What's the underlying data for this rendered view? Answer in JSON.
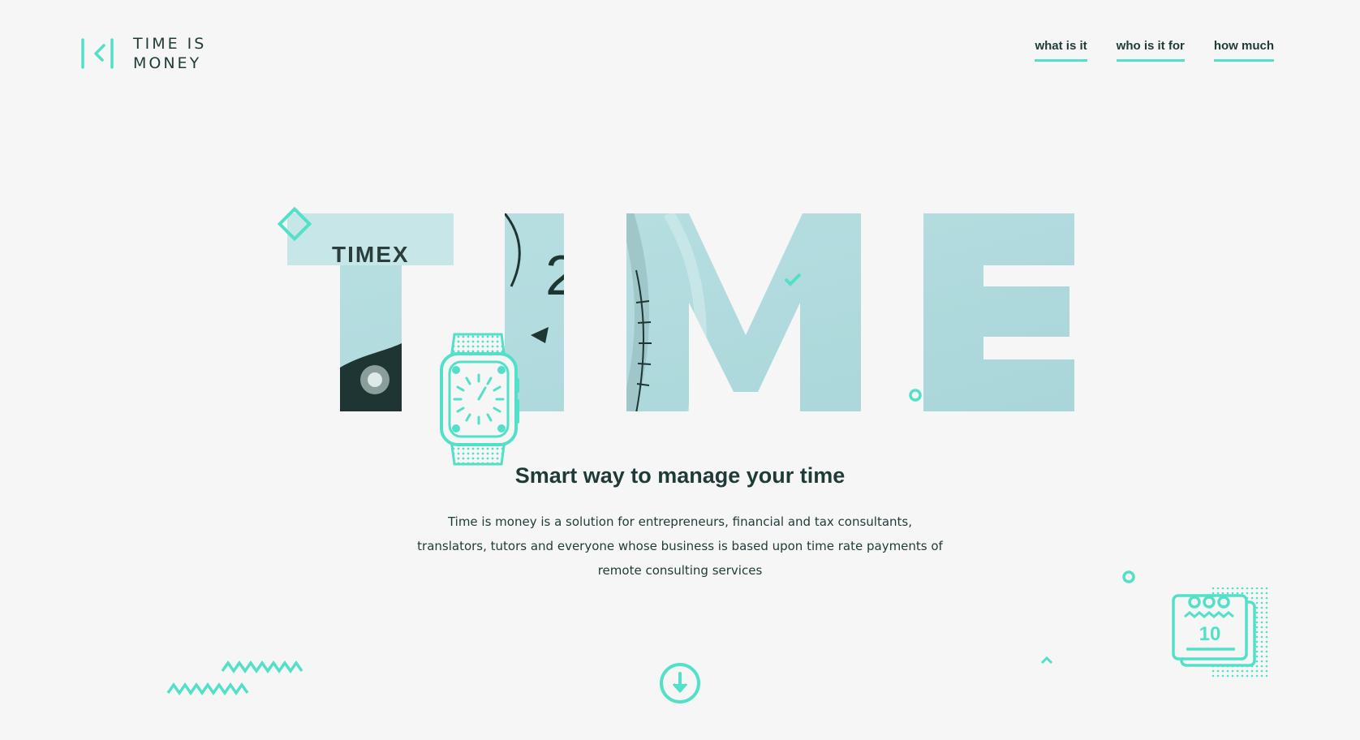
{
  "brand": {
    "line1": "TIME IS",
    "line2": "MONEY",
    "logo_icon": "k-bracket-logo-icon"
  },
  "nav": {
    "items": [
      {
        "label": "what is it"
      },
      {
        "label": "who is it for"
      },
      {
        "label": "how much"
      }
    ]
  },
  "hero": {
    "big_word": "TIME",
    "photo_label": "TIMEX",
    "headline": "Smart way to manage your time",
    "description": "Time is money is a solution for entrepreneurs, financial and tax consultants, translators, tutors and everyone whose business is based upon time rate payments of remote consulting services",
    "calendar_day": "10",
    "scroll_icon": "arrow-down-circle-icon"
  },
  "colors": {
    "accent": "#53e0c8",
    "letter_fill": "#b5dde0",
    "text": "#1f3b38",
    "background": "#f6f6f6"
  },
  "decorations": [
    "diamond-icon",
    "smartwatch-icon",
    "zigzag-icon",
    "ring-icon",
    "calendar-icon",
    "caret-up-icon",
    "check-tick-icon"
  ]
}
